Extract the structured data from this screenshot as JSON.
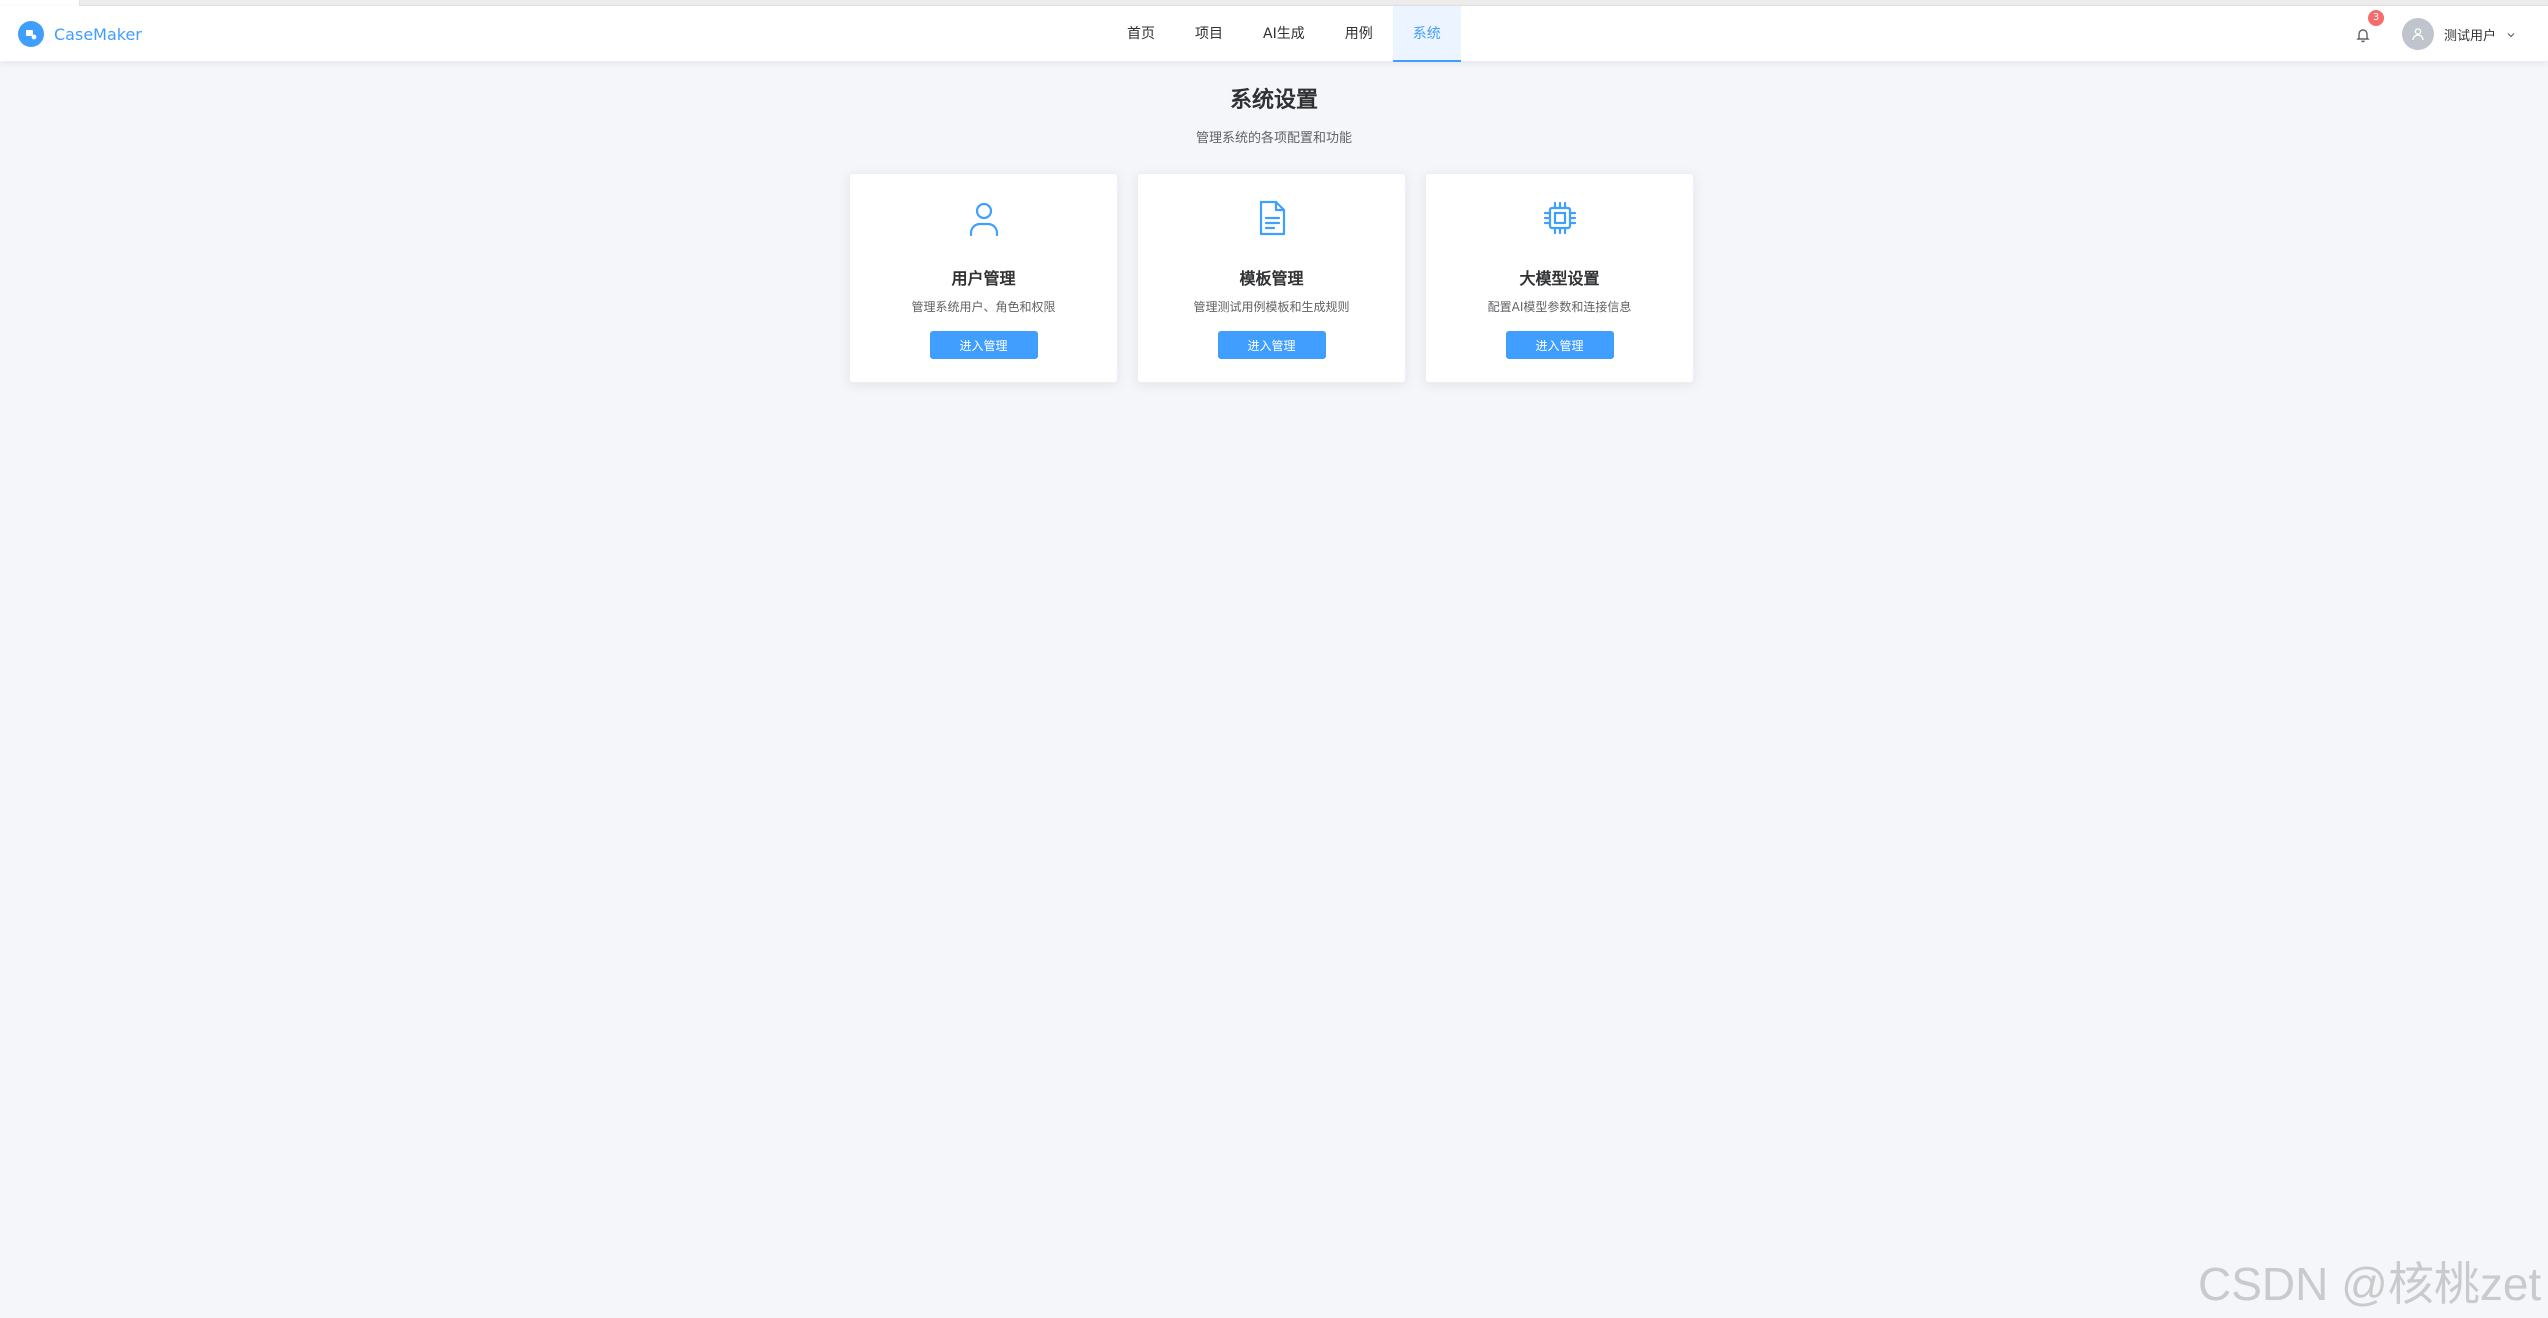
{
  "app": {
    "logo_text": "CaseMaker"
  },
  "nav": {
    "items": [
      {
        "label": "首页",
        "active": false
      },
      {
        "label": "项目",
        "active": false
      },
      {
        "label": "AI生成",
        "active": false
      },
      {
        "label": "用例",
        "active": false
      },
      {
        "label": "系统",
        "active": true
      }
    ]
  },
  "header": {
    "notification_count": "3",
    "user_name": "测试用户",
    "icons": {
      "bell": "bell-icon",
      "avatar": "user-avatar-icon",
      "dropdown": "chevron-down-icon"
    }
  },
  "page": {
    "title": "系统设置",
    "subtitle": "管理系统的各项配置和功能"
  },
  "cards": [
    {
      "icon": "user-icon",
      "title": "用户管理",
      "description": "管理系统用户、角色和权限",
      "button_label": "进入管理"
    },
    {
      "icon": "document-icon",
      "title": "模板管理",
      "description": "管理测试用例模板和生成规则",
      "button_label": "进入管理"
    },
    {
      "icon": "cpu-chip-icon",
      "title": "大模型设置",
      "description": "配置AI模型参数和连接信息",
      "button_label": "进入管理"
    }
  ],
  "watermark": "CSDN @核桃zet",
  "colors": {
    "primary": "#409eff",
    "badge": "#f56c6c",
    "background": "#f5f6f9"
  }
}
